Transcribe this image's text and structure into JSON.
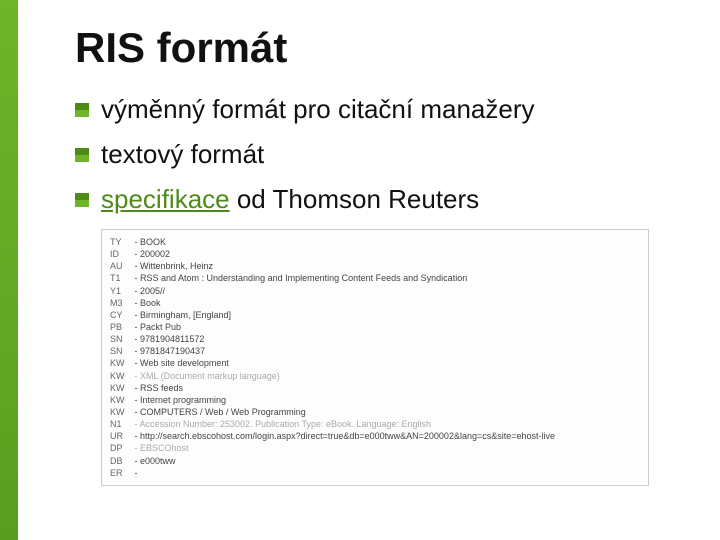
{
  "title": "RIS formát",
  "bullets": [
    {
      "text": "výměnný formát pro citační manažery"
    },
    {
      "text": "textový formát"
    },
    {
      "link": "specifikace",
      "rest": " od Thomson Reuters"
    }
  ],
  "ris_lines": [
    {
      "tag": "TY",
      "val": "BOOK"
    },
    {
      "tag": "ID",
      "val": "200002"
    },
    {
      "tag": "AU",
      "val": "Wittenbrink, Heinz"
    },
    {
      "tag": "T1",
      "val": "RSS and Atom : Understanding and Implementing Content Feeds and Syndication"
    },
    {
      "tag": "Y1",
      "val": "2005//"
    },
    {
      "tag": "M3",
      "val": "Book"
    },
    {
      "tag": "CY",
      "val": "Birmingham, [England]"
    },
    {
      "tag": "PB",
      "val": "Packt Pub"
    },
    {
      "tag": "SN",
      "val": "9781904811572"
    },
    {
      "tag": "SN",
      "val": "9781847190437"
    },
    {
      "tag": "KW",
      "val": "Web site development"
    },
    {
      "tag": "KW",
      "val": "XML (Document markup language)",
      "gray": true
    },
    {
      "tag": "KW",
      "val": "RSS feeds"
    },
    {
      "tag": "KW",
      "val": "Internet programming"
    },
    {
      "tag": "KW",
      "val": "COMPUTERS / Web / Web Programming"
    },
    {
      "tag": "N1",
      "val": "Accession Number: 253002. Publication Type: eBook. Language: English",
      "gray": true
    },
    {
      "tag": "UR",
      "val": "http://search.ebscohost.com/login.aspx?direct=true&db=e000tww&AN=200002&lang=cs&site=ehost-live"
    },
    {
      "tag": "DP",
      "val": "EBSCOhost",
      "gray": true
    },
    {
      "tag": "DB",
      "val": "e000tww"
    },
    {
      "tag": "ER",
      "val": ""
    }
  ]
}
